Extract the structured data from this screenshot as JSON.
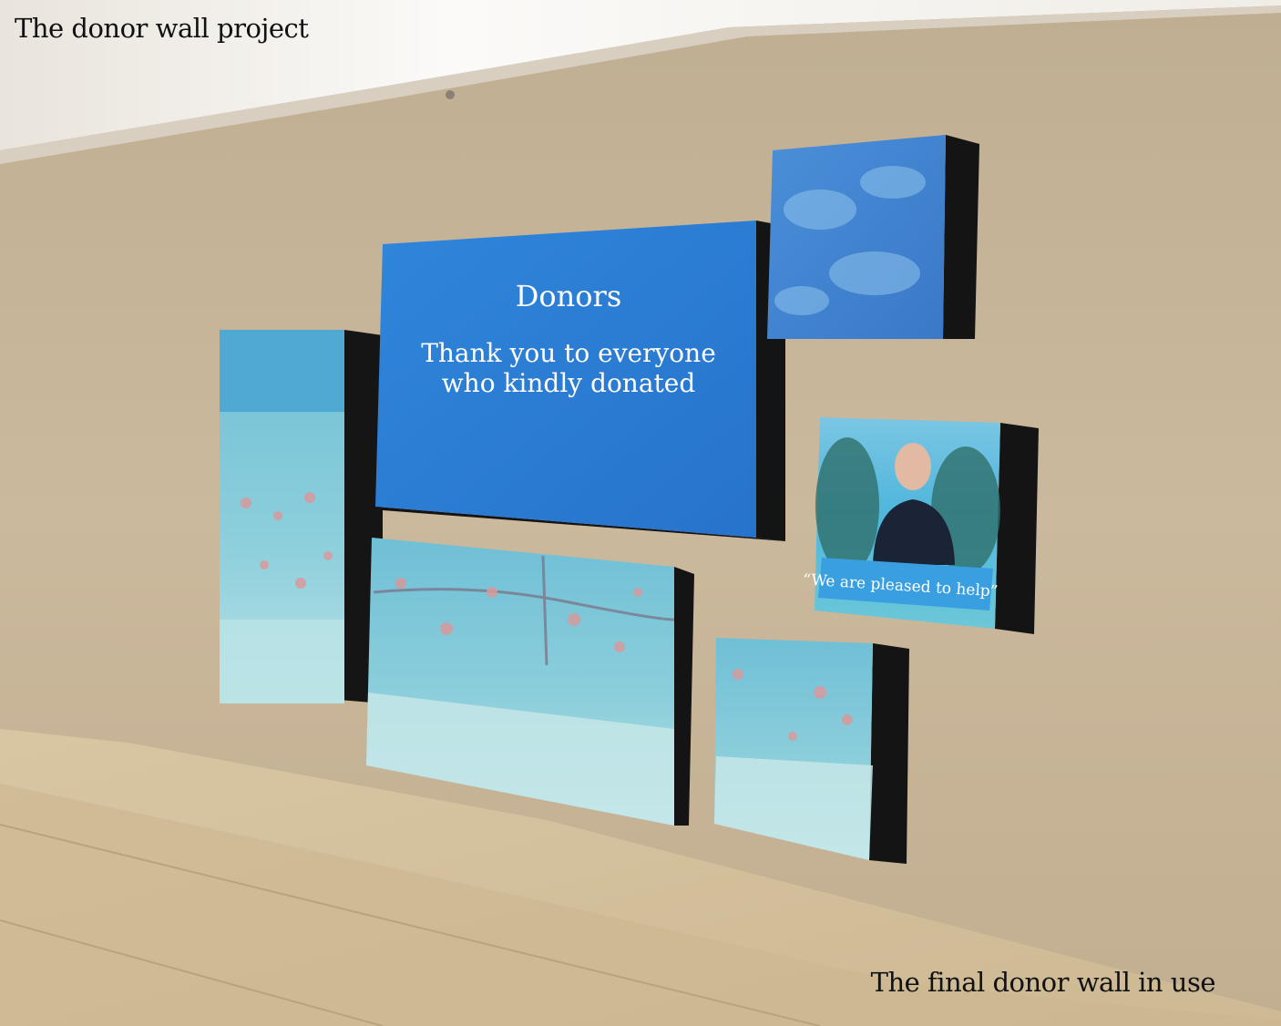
{
  "captions": {
    "top": "The donor wall project",
    "bottom": "The final donor wall in use"
  },
  "main_screen": {
    "heading": "Donors",
    "message_line1": "Thank you to everyone",
    "message_line2": "who kindly donated"
  },
  "quote_banner": {
    "text": "“We are pleased to  help”"
  },
  "colors": {
    "wall": "#c9b79c",
    "ceiling": "#f2efea",
    "main_screen_blue": "#2a7fd6",
    "screen_bezel": "#141414",
    "quote_banner": "#3a9fe0",
    "floor": "#d5c3a1"
  }
}
